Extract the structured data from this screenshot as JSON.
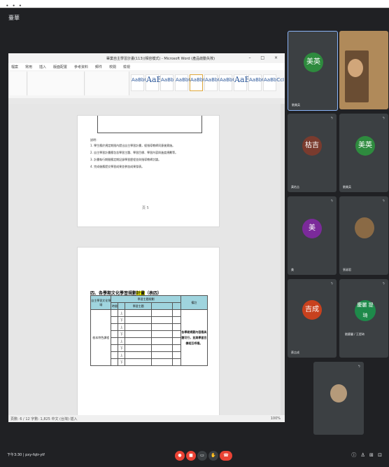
{
  "topbar": {
    "dots": "• • •",
    "meet_title": "臺華"
  },
  "word": {
    "title": "畢業自主學習計畫(113)(相容模式) - Microsoft Word (產品啟動失敗)",
    "controls": "– □ ×",
    "menus": [
      "檔案",
      "常用",
      "插入",
      "版面配置",
      "參考資料",
      "郵件",
      "校閱",
      "檢視"
    ],
    "styles": [
      "AaBbCcDd",
      "AaB",
      "AaBb",
      "AaBbCc",
      "AaBbCc",
      "AaBbCcI",
      "AaBbCcI",
      "AaBb",
      "AaBbC",
      "AaBbCcI"
    ],
    "status_left": "頁數: 6 / 12   字數: 1,825   中文 (台灣)   插入",
    "status_right": "100%"
  },
  "doc": {
    "notes_label": "說明：",
    "notes": [
      "1. 學生應於規定期限內提出自主學習計畫，經指導教師同意後實施。",
      "2. 自主學習計畫應包含學習主題、學習目標、學習內容與進度規劃等。",
      "3. 計畫執行期間應定期記錄學習歷程並與指導教師討論。",
      "4. 完成後應提交學習成果並參加成果發表。"
    ],
    "page_number": "頁 5",
    "section_heading_pre": "四、各學期文化學習規劃",
    "section_heading_hl": "計畫",
    "section_heading_post": "（表四）",
    "table_header_top": "學習主題規劃",
    "col_category": "自主學習文化領域",
    "col_time": "時間",
    "col_topic": "學習主題",
    "col_note": "備註",
    "row_group_label": "校本特色課程",
    "bold_note": "各學期規劃內容應具體可行，並與學習目標相互呼應。",
    "semesters": [
      "上",
      "下",
      "上",
      "下",
      "上",
      "下",
      "上",
      "下"
    ]
  },
  "participants": [
    {
      "avatar": "美英",
      "name": "劉美英",
      "color": "#2e8b3e"
    },
    {
      "avatar": "",
      "name": "",
      "color": ""
    },
    {
      "avatar": "枯吉",
      "name": "黃枯吉",
      "color": "#7a3b2e"
    },
    {
      "avatar": "美英",
      "name": "劉美英",
      "color": "#2e8b3e"
    },
    {
      "avatar": "美",
      "name": "美",
      "color": "#7b2a9a"
    },
    {
      "avatar": "",
      "name": "張淑君",
      "color": ""
    },
    {
      "avatar": "吉成",
      "name": "蔡吉成",
      "color": "#c8411e"
    },
    {
      "avatar": "慶麗 提琦",
      "name": "劉慶麗 / 王提琦",
      "color": "#1e8a4a"
    },
    {
      "avatar": "",
      "name": "",
      "color": ""
    }
  ],
  "bottom": {
    "meeting_code": "下午3:30 | pxy-fqtr-ytf",
    "right_icons": "ⓘ ♙ ⊞ ⊡"
  }
}
